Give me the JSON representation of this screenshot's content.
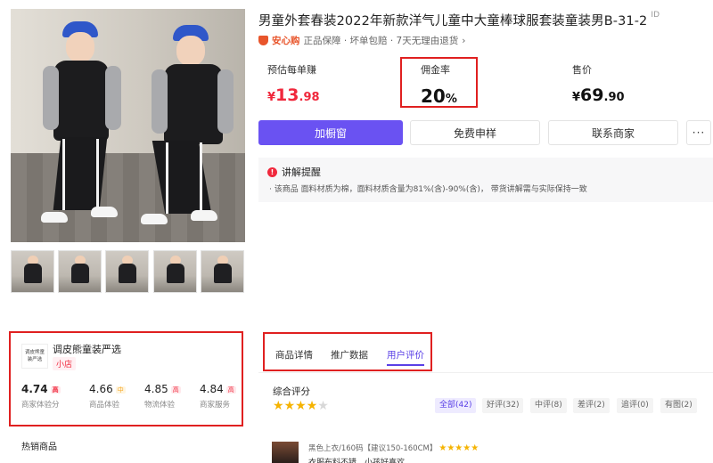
{
  "product": {
    "title": "男童外套春装2022年新款洋气儿童中大童棒球服套装童装男B-31-2",
    "title_tag": "ID",
    "guarantee_brand": "安心购",
    "guarantee_text": "正品保障 · 坏单包赔 · 7天无理由退货",
    "guarantee_arrow": "›"
  },
  "stats": {
    "earn": {
      "label": "预估每单赚",
      "currency": "¥",
      "int": "13",
      "dec": ".98"
    },
    "commission": {
      "label": "佣金率",
      "int": "20",
      "unit": "%"
    },
    "price": {
      "label": "售价",
      "currency": "¥",
      "int": "69",
      "dec": ".90"
    }
  },
  "buttons": {
    "add_window": "加橱窗",
    "free_sample": "免费申样",
    "contact": "联系商家",
    "more": "···"
  },
  "notice": {
    "title": "讲解提醒",
    "alert_glyph": "!",
    "body": "· 该商品 面料材质为棉，面料材质含量为81%(含)-90%(含)， 带货讲解需与实际保持一致"
  },
  "shop": {
    "logo_text": "调皮熊童 装严选",
    "name": "调皮熊童装严选",
    "badge": "小店",
    "scores": [
      {
        "value": "4.74",
        "level": "高",
        "caption": "商家体验分",
        "level_class": "high"
      },
      {
        "value": "4.66",
        "level": "中",
        "caption": "商品体验",
        "level_class": "mid"
      },
      {
        "value": "4.85",
        "level": "高",
        "caption": "物流体验",
        "level_class": "high"
      },
      {
        "value": "4.84",
        "level": "高",
        "caption": "商家服务",
        "level_class": "high"
      }
    ],
    "hot_title": "热销商品"
  },
  "tabs": [
    {
      "label": "商品详情",
      "active": false
    },
    {
      "label": "推广数据",
      "active": false
    },
    {
      "label": "用户评价",
      "active": true
    }
  ],
  "reviews": {
    "overall_label": "综合评分",
    "rating_stars": 4,
    "rating_max": 5,
    "filters": [
      {
        "label": "全部(42)",
        "active": true
      },
      {
        "label": "好评(32)",
        "active": false
      },
      {
        "label": "中评(8)",
        "active": false
      },
      {
        "label": "差评(2)",
        "active": false
      },
      {
        "label": "追评(0)",
        "active": false
      },
      {
        "label": "有图(2)",
        "active": false
      }
    ],
    "first": {
      "meta": "黑色上衣/160码【建议150-160CM】",
      "stars": "★★★★★",
      "text": "衣服布料不错，小孩好喜欢"
    }
  },
  "colors": {
    "accent": "#6a52f2",
    "price_red": "#f0283c",
    "highlight_box": "#e02020",
    "star": "#f5b301"
  }
}
